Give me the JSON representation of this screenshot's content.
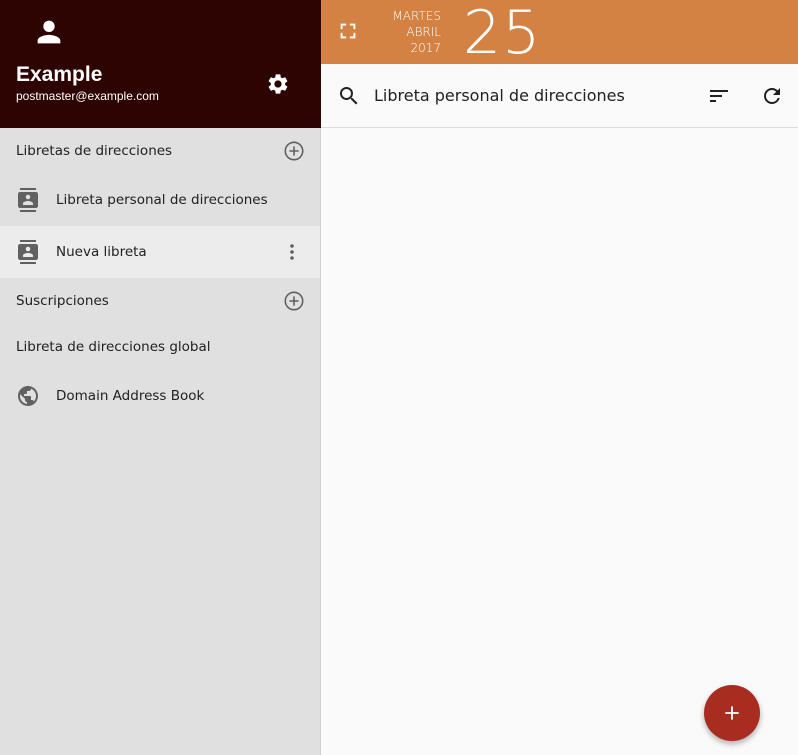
{
  "user": {
    "name": "Example",
    "email": "postmaster@example.com"
  },
  "sidebar": {
    "addressbooks_header": "Libretas de direcciones",
    "addressbooks": [
      {
        "label": "Libreta personal de direcciones"
      },
      {
        "label": "Nueva libreta"
      }
    ],
    "subscriptions_header": "Suscripciones",
    "global_header": "Libreta de direcciones global",
    "global_items": [
      {
        "label": "Domain Address Book"
      }
    ]
  },
  "datebar": {
    "weekday": "MARTES",
    "month": "ABRIL",
    "year": "2017",
    "day": "25"
  },
  "toolbar": {
    "title": "Libreta personal de direcciones"
  },
  "colors": {
    "header_bg": "#2e0403",
    "datebar_bg": "#d48244",
    "fab_bg": "#a82d20",
    "sidebar_bg": "#e0e0e0"
  }
}
